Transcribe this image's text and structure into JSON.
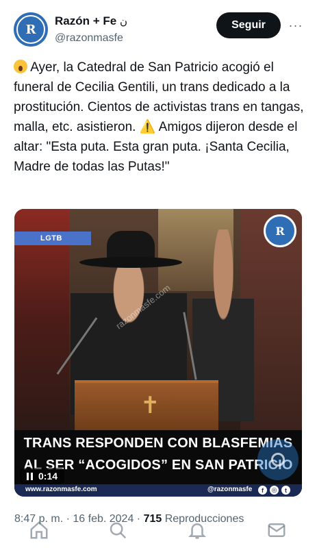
{
  "status_bar": {
    "left": "",
    "right": ""
  },
  "author": {
    "display_name": "Razón + Fe",
    "name_suffix": "ن",
    "handle": "@razonmasfe",
    "avatar_letters": "R"
  },
  "actions": {
    "follow_label": "Seguir",
    "more_label": "···"
  },
  "tweet": {
    "emoji_1": "scream-emoji",
    "part_1": " Ayer, la Catedral de San Patricio acogió el funeral de Cecilia Gentili, un trans dedicado a la prostitución. Cientos de activistas trans en tangas, malla, etc. asistieron. ",
    "emoji_2": "⚠️",
    "part_2": "Amigos dijeron desde el altar: \"Esta puta. Esta gran puta. ¡Santa Cecilia, Madre de todas las Putas!\""
  },
  "media": {
    "tag_label": "LGTB",
    "watermark": "razonmasfe.com",
    "logo_letters": "R",
    "caption_line_1": "TRANS RESPONDEN CON BLASFEMIAS",
    "caption_line_2": "AL SER “ACOGIDOS” EN SAN PATRICIO",
    "site_url": "www.razonmasfe.com",
    "social_handle": "@razonmasfe",
    "social_icons": [
      "f",
      "◎",
      "t"
    ],
    "play_time": "0:14",
    "lectern_cross": "✝"
  },
  "meta": {
    "time": "8:47 p. m.",
    "separator": " · ",
    "date": "16 feb. 2024",
    "views": "715",
    "views_label": " Reproducciones"
  },
  "tabbar": {
    "icons": [
      "home-icon",
      "search-icon",
      "notifications-icon",
      "messages-icon"
    ]
  },
  "colors": {
    "brand_blue": "#2f6db5",
    "button_dark": "#0f1419",
    "secondary_text": "#536471"
  }
}
